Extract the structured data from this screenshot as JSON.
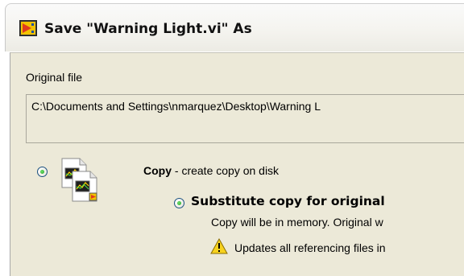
{
  "dialog": {
    "title": "Save \"Warning Light.vi\" As",
    "title_icon": "labview-vi-icon"
  },
  "original_file": {
    "label": "Original file",
    "path": "C:\\Documents and Settings\\nmarquez\\Desktop\\Warning L"
  },
  "copy_option": {
    "selected": true,
    "label_bold": "Copy",
    "label_rest": " - create copy on disk",
    "icon": "copy-files-icon"
  },
  "substitute_option": {
    "selected": true,
    "label": "Substitute copy for original",
    "description": "Copy will be in memory. Original w",
    "warning_icon": "warning-triangle-icon",
    "warning_text": "Updates all referencing files in"
  },
  "colors": {
    "radio_dot": "#21a121",
    "dialog_bg": "#ece9d8",
    "warning_yellow": "#f7d21e"
  }
}
